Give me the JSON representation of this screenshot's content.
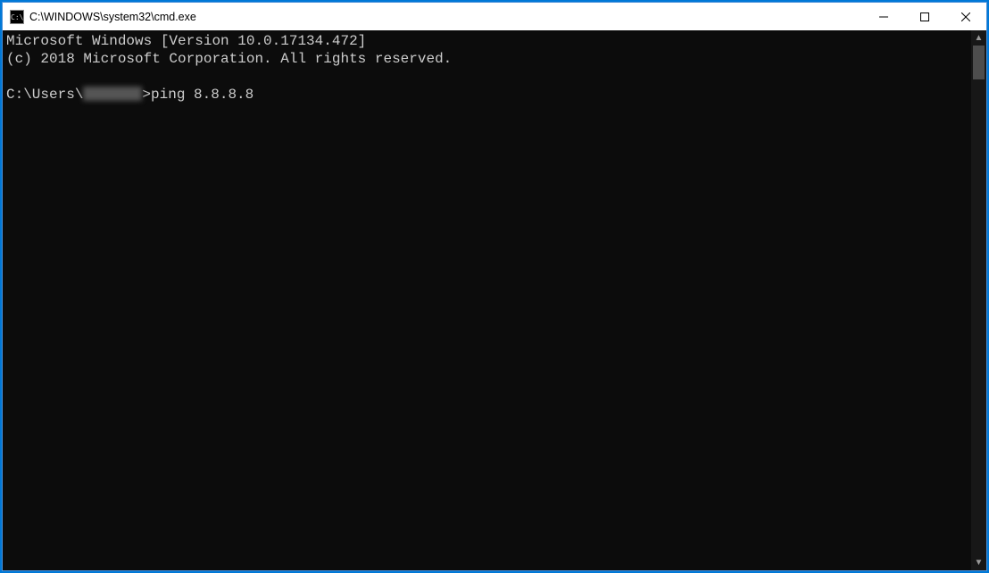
{
  "titlebar": {
    "icon_label": "C:\\",
    "title": "C:\\WINDOWS\\system32\\cmd.exe"
  },
  "terminal": {
    "line1": "Microsoft Windows [Version 10.0.17134.472]",
    "line2": "(c) 2018 Microsoft Corporation. All rights reserved.",
    "blank": "",
    "prompt_prefix": "C:\\Users\\",
    "prompt_suffix": ">",
    "command": "ping 8.8.8.8"
  },
  "controls": {
    "minimize": "Minimize",
    "maximize": "Maximize",
    "close": "Close"
  },
  "scrollbar": {
    "up": "▲",
    "down": "▼"
  }
}
